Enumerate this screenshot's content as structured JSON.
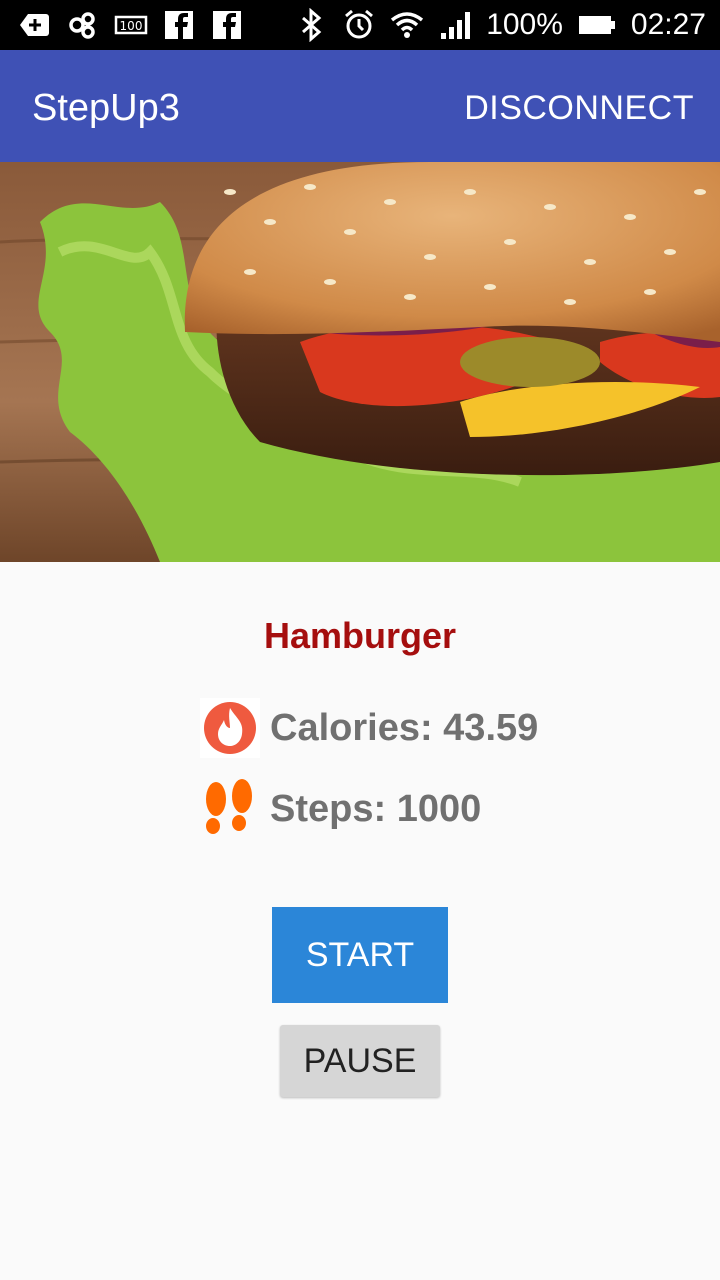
{
  "status_bar": {
    "icons_left": [
      "add-notification-icon",
      "link-icon",
      "storage-icon",
      "facebook-icon",
      "facebook-icon"
    ],
    "icons_right": [
      "bluetooth-icon",
      "alarm-icon",
      "wifi-icon",
      "signal-icon"
    ],
    "battery_percent": "100%",
    "battery_level": 1.0,
    "time": "02:27"
  },
  "app_bar": {
    "title": "StepUp3",
    "action_label": "DISCONNECT",
    "color": "#3f51b5"
  },
  "hero": {
    "subject": "hamburger-photo"
  },
  "food": {
    "name": "Hamburger",
    "name_color": "#a50e0e"
  },
  "stats": {
    "calories_label": "Calories: 43.59",
    "calories_icon": "flame-icon",
    "steps_label": "Steps: 1000",
    "steps_icon": "footprints-icon"
  },
  "buttons": {
    "start_label": "START",
    "start_color": "#2b86d8",
    "pause_label": "PAUSE"
  }
}
